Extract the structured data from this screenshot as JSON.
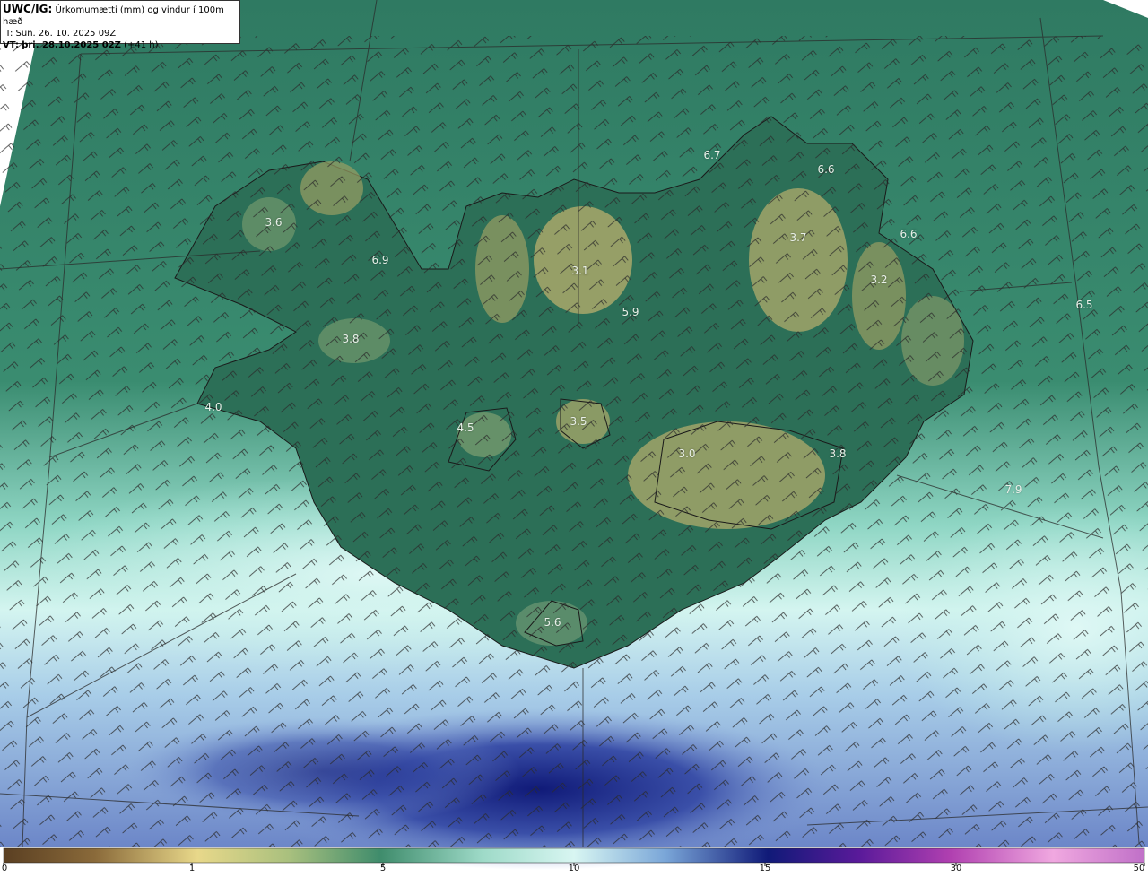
{
  "header": {
    "code": "UWC/IG:",
    "title": "Úrkomumætti (mm) og vindur í 100m hæð",
    "it_label": "IT:",
    "it_value": "Sun. 26. 10. 2025 09Z",
    "vt_label": "VT:",
    "vt_value": "þri. 28.10.2025 02Z",
    "vt_lead": "(+41 h)"
  },
  "map_labels": [
    "6.7",
    "6.6",
    "3.6",
    "6.9",
    "3.1",
    "3.7",
    "6.6",
    "3.2",
    "5.9",
    "6.5",
    "3.8",
    "4.0",
    "4.5",
    "3.5",
    "3.0",
    "3.8",
    "7.9",
    "5.6"
  ],
  "colorbar": {
    "ticks": [
      "0",
      "1",
      "5",
      "10",
      "15",
      "30",
      "50"
    ],
    "colors": [
      "#5a3f22",
      "#8a6a3a",
      "#b4a05a",
      "#e8d88a",
      "#9ab77a",
      "#3f8c6c",
      "#9edac8",
      "#d8f6f2",
      "#7aa6d8",
      "#3a58b0",
      "#101a78",
      "#5a1a9a",
      "#b040b0",
      "#f0a8e0"
    ]
  },
  "colors": {
    "sea_green": "#2f7a62",
    "land_dark": "#1f5a44",
    "land_highland": "#a9a86a",
    "rain_light": "#cdf3ee",
    "rain_heavy": "#1e2a8a"
  }
}
